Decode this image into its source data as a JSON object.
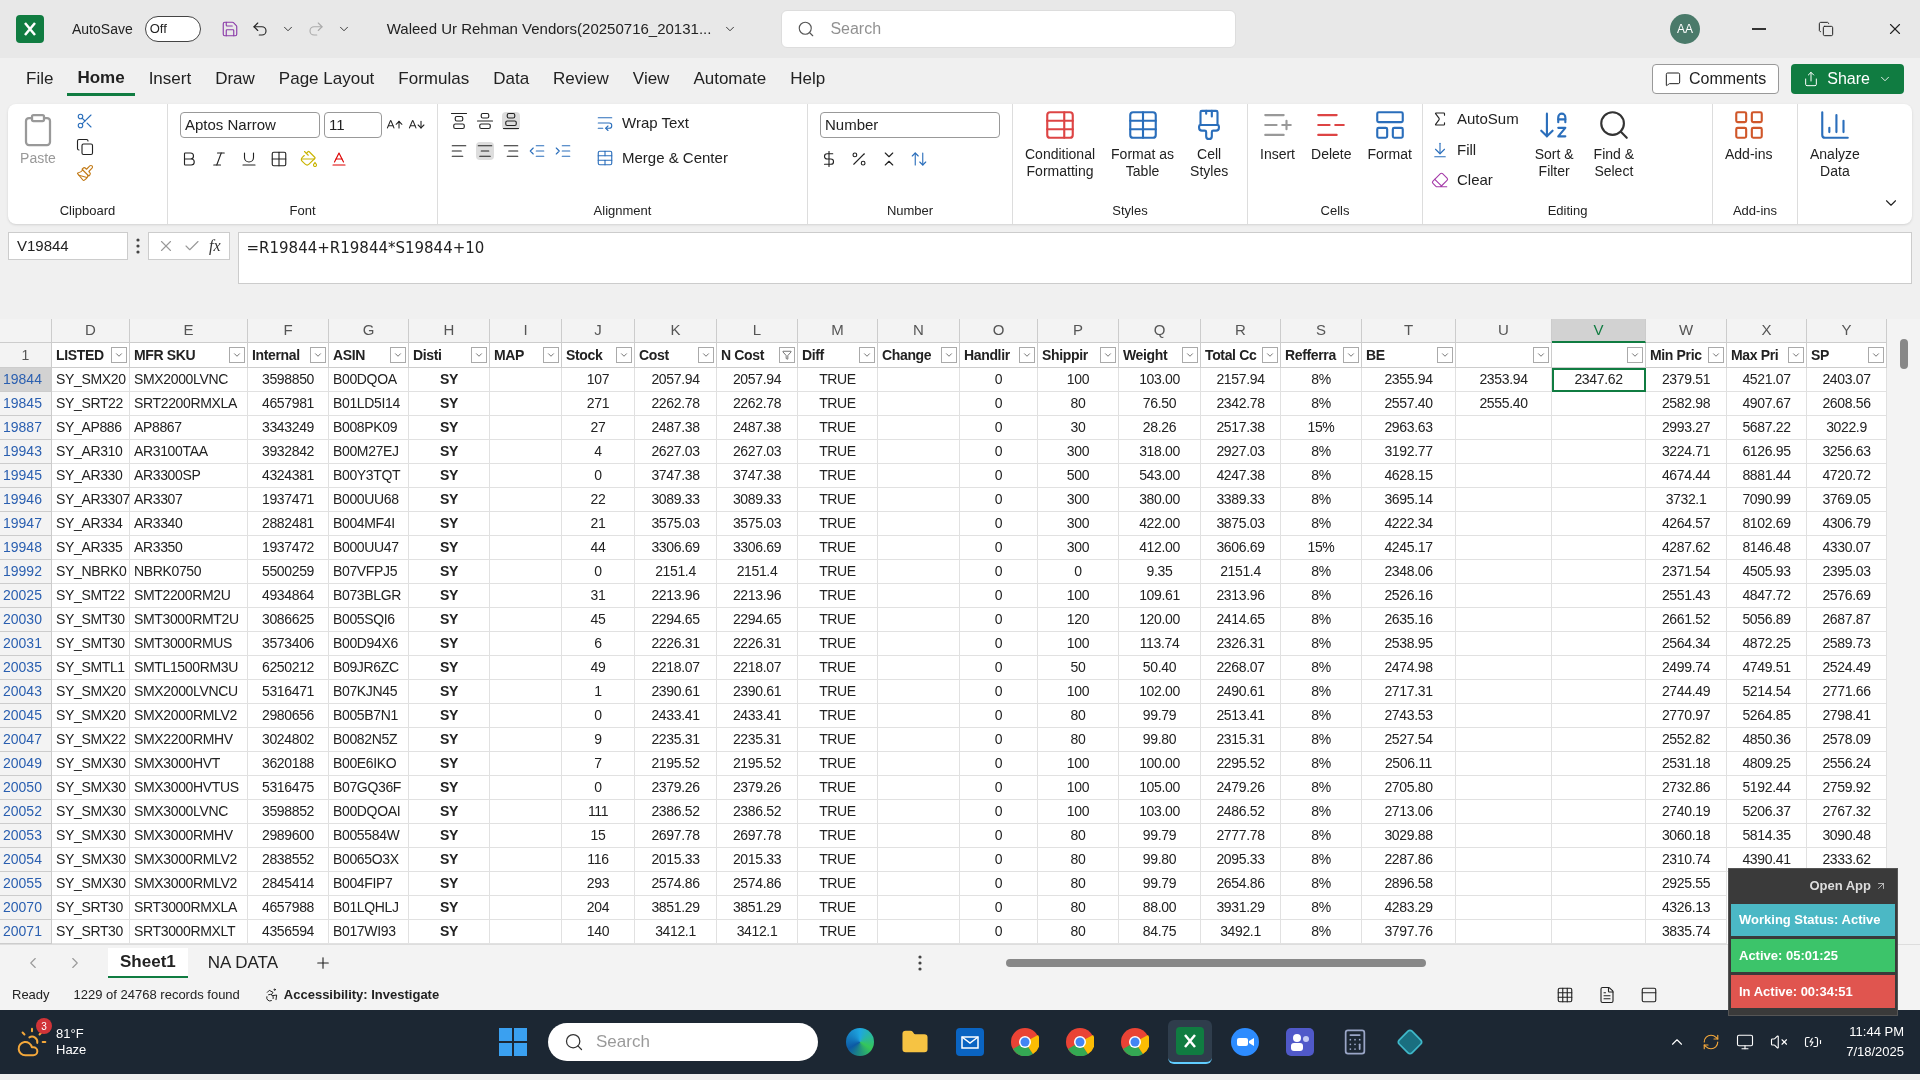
{
  "title_bar": {
    "autosave_label": "AutoSave",
    "autosave_on": false,
    "autosave_state": "Off",
    "document_title": "Waleed Ur Rehman Vendors(20250716_20131...",
    "search_placeholder": "Search",
    "avatar": "AA"
  },
  "menu_tabs": [
    {
      "label": "File",
      "selected": false
    },
    {
      "label": "Home",
      "selected": true
    },
    {
      "label": "Insert",
      "selected": false
    },
    {
      "label": "Draw",
      "selected": false
    },
    {
      "label": "Page Layout",
      "selected": false
    },
    {
      "label": "Formulas",
      "selected": false
    },
    {
      "label": "Data",
      "selected": false
    },
    {
      "label": "Review",
      "selected": false
    },
    {
      "label": "View",
      "selected": false
    },
    {
      "label": "Automate",
      "selected": false
    },
    {
      "label": "Help",
      "selected": false
    }
  ],
  "actions": {
    "comments": "Comments",
    "share": "Share"
  },
  "ribbon": {
    "clipboard": {
      "paste": "Paste",
      "label": "Clipboard"
    },
    "font": {
      "name": "Aptos Narrow",
      "size": "11",
      "label": "Font"
    },
    "alignment": {
      "wrap": "Wrap Text",
      "merge": "Merge & Center",
      "label": "Alignment"
    },
    "number": {
      "format": "Number",
      "label": "Number"
    },
    "styles": {
      "buttons": [
        [
          "Conditional",
          "Formatting"
        ],
        [
          "Format as",
          "Table"
        ],
        [
          "Cell",
          "Styles"
        ]
      ],
      "label": "Styles"
    },
    "cells": {
      "buttons": [
        "Insert",
        "Delete",
        "Format"
      ],
      "label": "Cells"
    },
    "editing": {
      "autosum": "AutoSum",
      "fill": "Fill",
      "clear": "Clear",
      "sort": [
        "Sort &",
        "Filter"
      ],
      "find": [
        "Find &",
        "Select"
      ],
      "label": "Editing"
    },
    "addins": {
      "button": "Add-ins",
      "label": "Add-ins"
    },
    "analyze": [
      "Analyze",
      "Data"
    ]
  },
  "formula_bar": {
    "name_box": "V19844",
    "function_label": "fx",
    "formula": "=R19844+R19844*S19844+10"
  },
  "sheet": {
    "header_row": "1",
    "columns": [
      {
        "letter": "D",
        "header": "LISTED",
        "selected": false,
        "filtered": false
      },
      {
        "letter": "E",
        "header": "MFR SKU",
        "selected": false,
        "filtered": false
      },
      {
        "letter": "F",
        "header": "Internal",
        "selected": false,
        "filtered": false
      },
      {
        "letter": "G",
        "header": "ASIN",
        "selected": false,
        "filtered": false
      },
      {
        "letter": "H",
        "header": "Disti",
        "selected": false,
        "filtered": false
      },
      {
        "letter": "I",
        "header": "MAP",
        "selected": false,
        "filtered": false
      },
      {
        "letter": "J",
        "header": "Stock",
        "selected": false,
        "filtered": false
      },
      {
        "letter": "K",
        "header": "Cost",
        "selected": false,
        "filtered": false
      },
      {
        "letter": "L",
        "header": "N Cost",
        "selected": false,
        "filtered": true
      },
      {
        "letter": "M",
        "header": "Diff",
        "selected": false,
        "filtered": false
      },
      {
        "letter": "N",
        "header": "Change",
        "selected": false,
        "filtered": false
      },
      {
        "letter": "O",
        "header": "Handlir",
        "selected": false,
        "filtered": false
      },
      {
        "letter": "P",
        "header": "Shippir",
        "selected": false,
        "filtered": false
      },
      {
        "letter": "Q",
        "header": "Weight",
        "selected": false,
        "filtered": false
      },
      {
        "letter": "R",
        "header": "Total Cc",
        "selected": false,
        "filtered": false
      },
      {
        "letter": "S",
        "header": "Refferra",
        "selected": false,
        "filtered": false
      },
      {
        "letter": "T",
        "header": "BE",
        "selected": false,
        "filtered": false
      },
      {
        "letter": "U",
        "selected": false,
        "filtered": false
      },
      {
        "letter": "V",
        "selected": true,
        "filtered": false
      },
      {
        "letter": "W",
        "header": "Min Pric",
        "selected": false,
        "filtered": false
      },
      {
        "letter": "X",
        "header": "Max Pri",
        "selected": false,
        "filtered": false
      },
      {
        "letter": "Y",
        "header": "SP",
        "selected": false,
        "filtered": false
      }
    ],
    "rows": [
      {
        "number": "19844",
        "selected": true,
        "cells": [
          "SY_SMX20",
          "SMX2000LVNC",
          "3598850",
          "B00DQOA",
          "SY",
          null,
          "107",
          "2057.94",
          "2057.94",
          "TRUE",
          null,
          "0",
          "100",
          "103.00",
          "2157.94",
          "8%",
          "2355.94",
          "2353.94",
          "2347.62",
          "2379.51",
          "4521.07",
          "2403.07"
        ]
      },
      {
        "number": "19845",
        "selected": false,
        "cells": [
          "SY_SRT22",
          "SRT2200RMXLA",
          "4657981",
          "B01LD5I14",
          "SY",
          null,
          "271",
          "2262.78",
          "2262.78",
          "TRUE",
          null,
          "0",
          "80",
          "76.50",
          "2342.78",
          "8%",
          "2557.40",
          "2555.40",
          null,
          "2582.98",
          "4907.67",
          "2608.56"
        ]
      },
      {
        "number": "19887",
        "selected": false,
        "cells": [
          "SY_AP886",
          "AP8867",
          "3343249",
          "B008PK09",
          "SY",
          null,
          "27",
          "2487.38",
          "2487.38",
          "TRUE",
          null,
          "0",
          "30",
          "28.26",
          "2517.38",
          "15%",
          "2963.63",
          null,
          null,
          "2993.27",
          "5687.22",
          "3022.9"
        ]
      },
      {
        "number": "19943",
        "selected": false,
        "cells": [
          "SY_AR310",
          "AR3100TAA",
          "3932842",
          "B00M27EJ",
          "SY",
          null,
          "4",
          "2627.03",
          "2627.03",
          "TRUE",
          null,
          "0",
          "300",
          "318.00",
          "2927.03",
          "8%",
          "3192.77",
          null,
          null,
          "3224.71",
          "6126.95",
          "3256.63"
        ]
      },
      {
        "number": "19945",
        "selected": false,
        "cells": [
          "SY_AR330",
          "AR3300SP",
          "4324381",
          "B00Y3TQT",
          "SY",
          null,
          "0",
          "3747.38",
          "3747.38",
          "TRUE",
          null,
          "0",
          "500",
          "543.00",
          "4247.38",
          "8%",
          "4628.15",
          null,
          null,
          "4674.44",
          "8881.44",
          "4720.72"
        ]
      },
      {
        "number": "19946",
        "selected": false,
        "cells": [
          "SY_AR3307",
          "AR3307",
          "1937471",
          "B000UU68",
          "SY",
          null,
          "22",
          "3089.33",
          "3089.33",
          "TRUE",
          null,
          "0",
          "300",
          "380.00",
          "3389.33",
          "8%",
          "3695.14",
          null,
          null,
          "3732.1",
          "7090.99",
          "3769.05"
        ]
      },
      {
        "number": "19947",
        "selected": false,
        "cells": [
          "SY_AR334",
          "AR3340",
          "2882481",
          "B004MF4I",
          "SY",
          null,
          "21",
          "3575.03",
          "3575.03",
          "TRUE",
          null,
          "0",
          "300",
          "422.00",
          "3875.03",
          "8%",
          "4222.34",
          null,
          null,
          "4264.57",
          "8102.69",
          "4306.79"
        ]
      },
      {
        "number": "19948",
        "selected": false,
        "cells": [
          "SY_AR335",
          "AR3350",
          "1937472",
          "B000UU47",
          "SY",
          null,
          "44",
          "3306.69",
          "3306.69",
          "TRUE",
          null,
          "0",
          "300",
          "412.00",
          "3606.69",
          "15%",
          "4245.17",
          null,
          null,
          "4287.62",
          "8146.48",
          "4330.07"
        ]
      },
      {
        "number": "19992",
        "selected": false,
        "cells": [
          "SY_NBRK0",
          "NBRK0750",
          "5500259",
          "B07VFPJ5",
          "SY",
          null,
          "0",
          "2151.4",
          "2151.4",
          "TRUE",
          null,
          "0",
          "0",
          "9.35",
          "2151.4",
          "8%",
          "2348.06",
          null,
          null,
          "2371.54",
          "4505.93",
          "2395.03"
        ]
      },
      {
        "number": "20025",
        "selected": false,
        "cells": [
          "SY_SMT22",
          "SMT2200RM2U",
          "4934864",
          "B073BLGR",
          "SY",
          null,
          "31",
          "2213.96",
          "2213.96",
          "TRUE",
          null,
          "0",
          "100",
          "109.61",
          "2313.96",
          "8%",
          "2526.16",
          null,
          null,
          "2551.43",
          "4847.72",
          "2576.69"
        ]
      },
      {
        "number": "20030",
        "selected": false,
        "cells": [
          "SY_SMT30",
          "SMT3000RMT2U",
          "3086625",
          "B005SQI6",
          "SY",
          null,
          "45",
          "2294.65",
          "2294.65",
          "TRUE",
          null,
          "0",
          "120",
          "120.00",
          "2414.65",
          "8%",
          "2635.16",
          null,
          null,
          "2661.52",
          "5056.89",
          "2687.87"
        ]
      },
      {
        "number": "20031",
        "selected": false,
        "cells": [
          "SY_SMT30",
          "SMT3000RMUS",
          "3573406",
          "B00D94X6",
          "SY",
          null,
          "6",
          "2226.31",
          "2226.31",
          "TRUE",
          null,
          "0",
          "100",
          "113.74",
          "2326.31",
          "8%",
          "2538.95",
          null,
          null,
          "2564.34",
          "4872.25",
          "2589.73"
        ]
      },
      {
        "number": "20035",
        "selected": false,
        "cells": [
          "SY_SMTL1",
          "SMTL1500RM3U",
          "6250212",
          "B09JR6ZC",
          "SY",
          null,
          "49",
          "2218.07",
          "2218.07",
          "TRUE",
          null,
          "0",
          "50",
          "50.40",
          "2268.07",
          "8%",
          "2474.98",
          null,
          null,
          "2499.74",
          "4749.51",
          "2524.49"
        ]
      },
      {
        "number": "20043",
        "selected": false,
        "cells": [
          "SY_SMX20",
          "SMX2000LVNCU",
          "5316471",
          "B07KJN45",
          "SY",
          null,
          "1",
          "2390.61",
          "2390.61",
          "TRUE",
          null,
          "0",
          "100",
          "102.00",
          "2490.61",
          "8%",
          "2717.31",
          null,
          null,
          "2744.49",
          "5214.54",
          "2771.66"
        ]
      },
      {
        "number": "20045",
        "selected": false,
        "cells": [
          "SY_SMX20",
          "SMX2000RMLV2",
          "2980656",
          "B005B7N1",
          "SY",
          null,
          "0",
          "2433.41",
          "2433.41",
          "TRUE",
          null,
          "0",
          "80",
          "99.79",
          "2513.41",
          "8%",
          "2743.53",
          null,
          null,
          "2770.97",
          "5264.85",
          "2798.41"
        ]
      },
      {
        "number": "20047",
        "selected": false,
        "cells": [
          "SY_SMX22",
          "SMX2200RMHV",
          "3024802",
          "B0082N5Z",
          "SY",
          null,
          "9",
          "2235.31",
          "2235.31",
          "TRUE",
          null,
          "0",
          "80",
          "99.80",
          "2315.31",
          "8%",
          "2527.54",
          null,
          null,
          "2552.82",
          "4850.36",
          "2578.09"
        ]
      },
      {
        "number": "20049",
        "selected": false,
        "cells": [
          "SY_SMX30",
          "SMX3000HVT",
          "3620188",
          "B00E6IKO",
          "SY",
          null,
          "7",
          "2195.52",
          "2195.52",
          "TRUE",
          null,
          "0",
          "100",
          "100.00",
          "2295.52",
          "8%",
          "2506.11",
          null,
          null,
          "2531.18",
          "4809.25",
          "2556.24"
        ]
      },
      {
        "number": "20050",
        "selected": false,
        "cells": [
          "SY_SMX30",
          "SMX3000HVTUS",
          "5316475",
          "B07GQ36F",
          "SY",
          null,
          "0",
          "2379.26",
          "2379.26",
          "TRUE",
          null,
          "0",
          "100",
          "105.00",
          "2479.26",
          "8%",
          "2705.80",
          null,
          null,
          "2732.86",
          "5192.44",
          "2759.92"
        ]
      },
      {
        "number": "20052",
        "selected": false,
        "cells": [
          "SY_SMX30",
          "SMX3000LVNC",
          "3598852",
          "B00DQOAI",
          "SY",
          null,
          "111",
          "2386.52",
          "2386.52",
          "TRUE",
          null,
          "0",
          "100",
          "103.00",
          "2486.52",
          "8%",
          "2713.06",
          null,
          null,
          "2740.19",
          "5206.37",
          "2767.32"
        ]
      },
      {
        "number": "20053",
        "selected": false,
        "cells": [
          "SY_SMX30",
          "SMX3000RMHV",
          "2989600",
          "B005584W",
          "SY",
          null,
          "15",
          "2697.78",
          "2697.78",
          "TRUE",
          null,
          "0",
          "80",
          "99.79",
          "2777.78",
          "8%",
          "3029.88",
          null,
          null,
          "3060.18",
          "5814.35",
          "3090.48"
        ]
      },
      {
        "number": "20054",
        "selected": false,
        "cells": [
          "SY_SMX30",
          "SMX3000RMLV2",
          "2838552",
          "B0065O3X",
          "SY",
          null,
          "116",
          "2015.33",
          "2015.33",
          "TRUE",
          null,
          "0",
          "80",
          "99.80",
          "2095.33",
          "8%",
          "2287.86",
          null,
          null,
          "2310.74",
          "4390.41",
          "2333.62"
        ]
      },
      {
        "number": "20055",
        "selected": false,
        "cells": [
          "SY_SMX30",
          "SMX3000RMLV2",
          "2845414",
          "B004FIP7",
          "SY",
          null,
          "293",
          "2574.86",
          "2574.86",
          "TRUE",
          null,
          "0",
          "80",
          "99.79",
          "2654.86",
          "8%",
          "2896.58",
          null,
          null,
          "2925.55"
        ]
      },
      {
        "number": "20070",
        "selected": false,
        "cells": [
          "SY_SRT30",
          "SRT3000RMXLA",
          "4657988",
          "B01LQHLJ",
          "SY",
          null,
          "204",
          "3851.29",
          "3851.29",
          "TRUE",
          null,
          "0",
          "80",
          "88.00",
          "3931.29",
          "8%",
          "4283.29",
          null,
          null,
          "4326.13"
        ]
      },
      {
        "number": "20071",
        "selected": false,
        "cells": [
          "SY_SRT30",
          "SRT3000RMXLT",
          "4356594",
          "B017WI93",
          "SY",
          null,
          "140",
          "3412.1",
          "3412.1",
          "TRUE",
          null,
          "0",
          "80",
          "84.75",
          "3492.1",
          "8%",
          "3797.76",
          null,
          null,
          "3835.74"
        ]
      }
    ]
  },
  "sheet_tabs": [
    {
      "label": "Sheet1",
      "selected": true
    },
    {
      "label": "NA DATA",
      "selected": false
    }
  ],
  "status_bar": {
    "ready": "Ready",
    "records": "1229 of 24768 records found",
    "accessibility": "Accessibility: Investigate"
  },
  "tracker_widget": {
    "open_app": "Open App",
    "status": "Working Status: Active",
    "active": "Active: 05:01:25",
    "inactive": "In Active: 00:34:51"
  },
  "taskbar": {
    "weather": {
      "badge": "3",
      "temp": "81°F",
      "condition": "Haze"
    },
    "search_placeholder": "Search",
    "apps": [
      {
        "kind": "edge",
        "active": false
      },
      {
        "kind": "files",
        "active": false
      },
      {
        "kind": "outlook",
        "active": false
      },
      {
        "kind": "chrome",
        "active": false
      },
      {
        "kind": "chrome",
        "active": false
      },
      {
        "kind": "chrome",
        "active": false
      },
      {
        "kind": "excel",
        "active": true
      },
      {
        "kind": "zoom",
        "active": false
      },
      {
        "kind": "teams",
        "active": false
      },
      {
        "kind": "calculator",
        "active": false
      },
      {
        "kind": "diamond",
        "active": false
      }
    ],
    "time": "11:44 PM",
    "date": "7/18/2025"
  }
}
